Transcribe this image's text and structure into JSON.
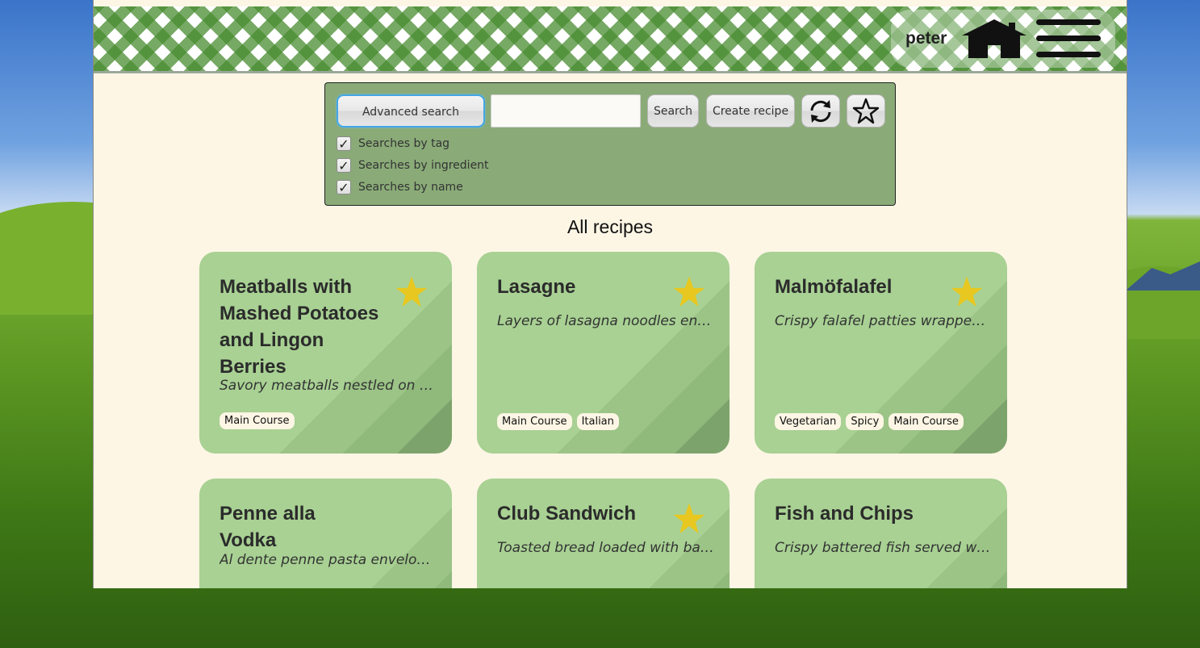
{
  "header": {
    "username": "peter"
  },
  "search": {
    "advanced_label": "Advanced search",
    "input_value": "",
    "search_label": "Search",
    "create_label": "Create recipe",
    "options": [
      {
        "label": "Searches by tag",
        "checked": true
      },
      {
        "label": "Searches by ingredient",
        "checked": true
      },
      {
        "label": "Searches by name",
        "checked": true
      }
    ]
  },
  "main": {
    "title": "All recipes"
  },
  "recipes": [
    {
      "title": "Meatballs with Mashed Potatoes and Lingon Berries",
      "description": "Savory meatballs nestled on a ...",
      "favorite": true,
      "tags": [
        "Main Course"
      ]
    },
    {
      "title": "Lasagne",
      "description": "Layers of lasagna noodles enve...",
      "favorite": true,
      "tags": [
        "Main Course",
        "Italian"
      ]
    },
    {
      "title": "Malmöfalafel",
      "description": "Crispy falafel patties wrapped i...",
      "favorite": true,
      "tags": [
        "Vegetarian",
        "Spicy",
        "Main Course"
      ]
    },
    {
      "title": "Penne alla Vodka",
      "description": "Al dente penne pasta envelope...",
      "favorite": false,
      "tags": []
    },
    {
      "title": "Club Sandwich",
      "description": "Toasted bread loaded with bac...",
      "favorite": true,
      "tags": []
    },
    {
      "title": "Fish and Chips",
      "description": "Crispy battered fish served with...",
      "favorite": false,
      "tags": []
    }
  ],
  "colors": {
    "card": "#a8d193",
    "panel": "#8aab78",
    "star": "#e8c820",
    "page": "#fdf6e5"
  },
  "icons": {
    "home": "home-icon",
    "menu": "hamburger-menu-icon",
    "refresh": "refresh-icon",
    "favorites": "star-icon"
  }
}
